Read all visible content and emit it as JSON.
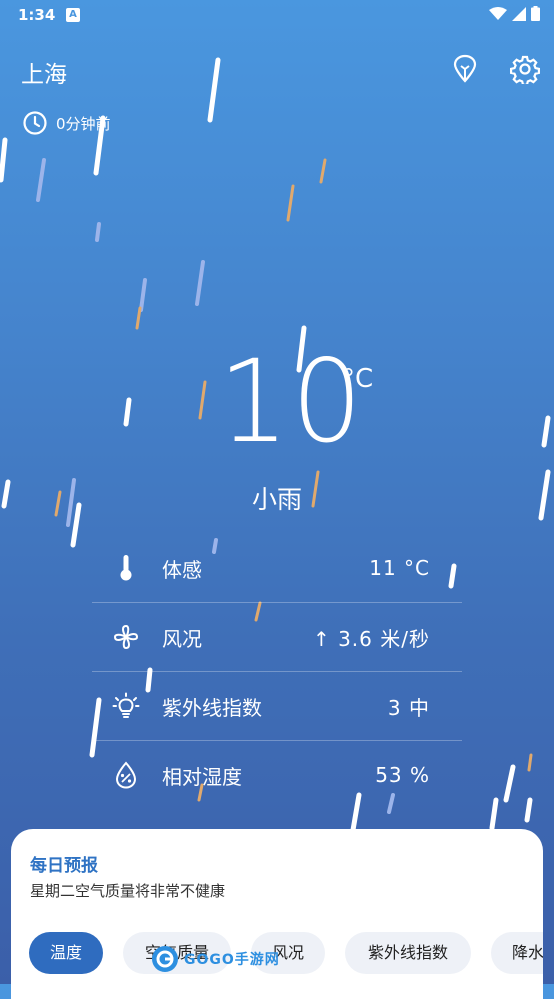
{
  "status_bar": {
    "time": "1:34",
    "notification_letter": "A"
  },
  "header": {
    "city": "上海",
    "updated": "0分钟前"
  },
  "current": {
    "temperature": "10",
    "unit": "°C",
    "condition": "小雨"
  },
  "details": [
    {
      "icon": "thermometer-icon",
      "label": "体感",
      "value": "11 °C"
    },
    {
      "icon": "fan-icon",
      "label": "风况",
      "value": "↑ 3.6 米/秒"
    },
    {
      "icon": "lightbulb-icon",
      "label": "紫外线指数",
      "value": "3 中"
    },
    {
      "icon": "humidity-icon",
      "label": "相对湿度",
      "value": "53 %"
    }
  ],
  "daily": {
    "title": "每日预报",
    "subtitle": "星期二空气质量将非常不健康",
    "chips": [
      "温度",
      "空气质量",
      "风况",
      "紫外线指数",
      "降水"
    ],
    "active_chip": 0
  },
  "watermark": {
    "text": "GOGO手游网"
  },
  "colors": {
    "sky_top": "#4a97df",
    "sky_bottom": "#3b5fa9",
    "accent": "#2f6cbf",
    "card_title": "#2f73c4",
    "rain_orange": "#e0a96d"
  }
}
